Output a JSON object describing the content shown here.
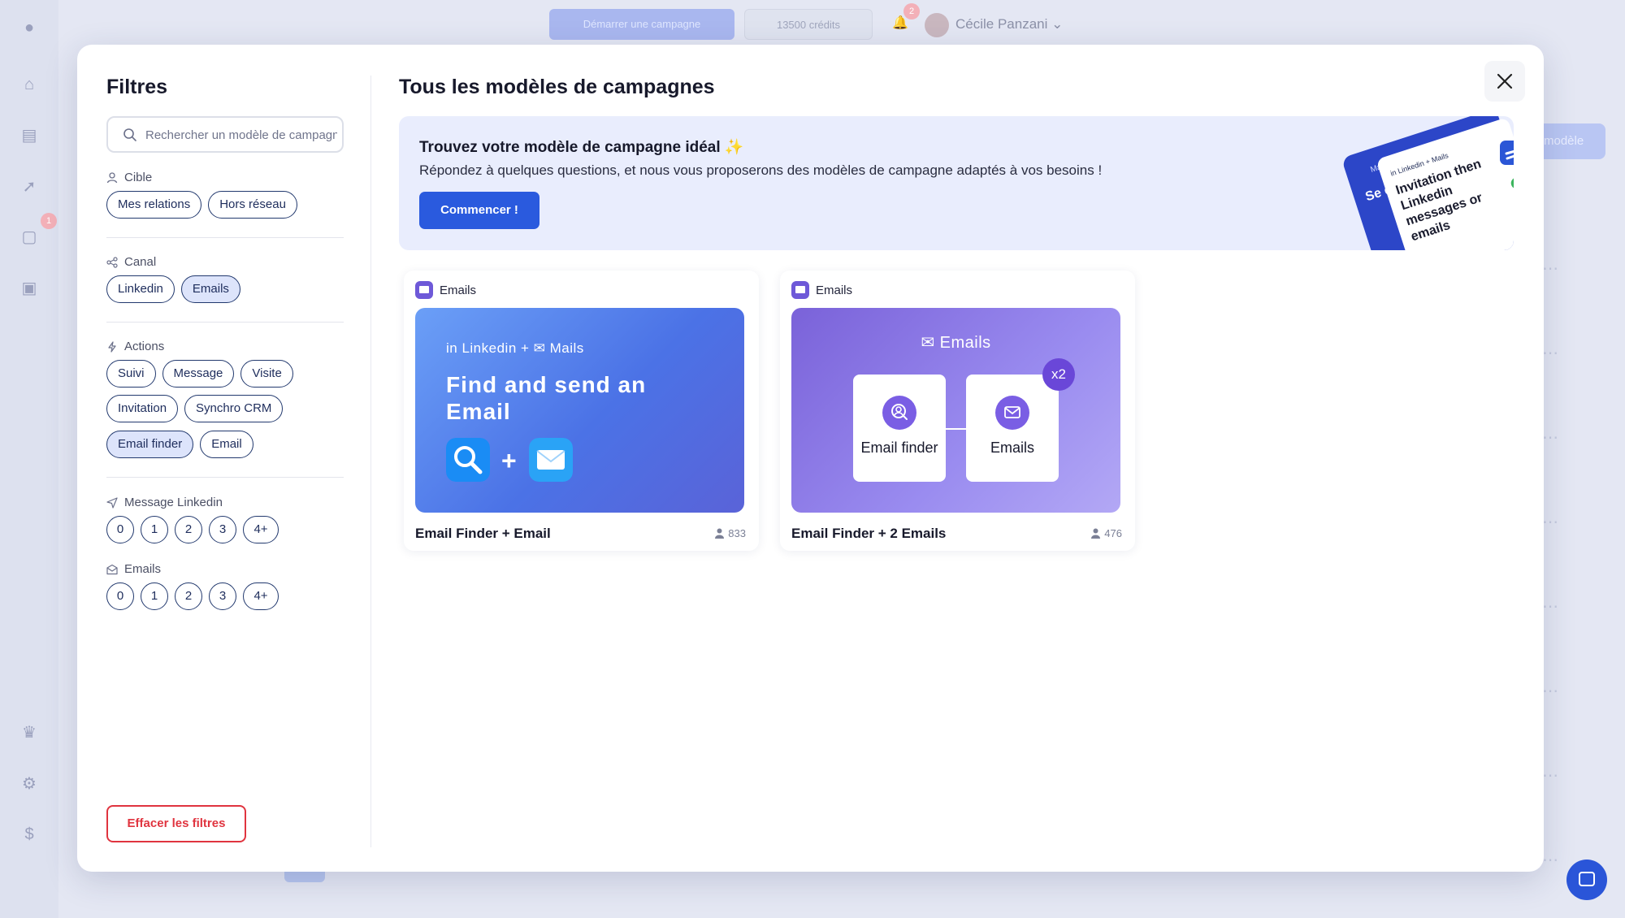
{
  "topbar": {
    "start_campaign": "Démarrer une campagne",
    "credits": "13500 crédits",
    "notifications_count": "2",
    "user_name": "Cécile Panzani"
  },
  "sidebar": {
    "badge_count": "1"
  },
  "background": {
    "right_button_label": "modèle"
  },
  "filters": {
    "title": "Filtres",
    "search_placeholder": "Rechercher un modèle de campagne",
    "target": {
      "label": "Cible",
      "options": [
        "Mes relations",
        "Hors réseau"
      ]
    },
    "channel": {
      "label": "Canal",
      "options": [
        "Linkedin",
        "Emails"
      ],
      "selected": [
        "Emails"
      ]
    },
    "actions": {
      "label": "Actions",
      "options": [
        "Suivi",
        "Message",
        "Visite",
        "Invitation",
        "Synchro CRM",
        "Email finder",
        "Email"
      ],
      "selected": [
        "Email finder"
      ]
    },
    "linkedin_messages": {
      "label": "Message Linkedin",
      "options": [
        "0",
        "1",
        "2",
        "3",
        "4+"
      ]
    },
    "emails": {
      "label": "Emails",
      "options": [
        "0",
        "1",
        "2",
        "3",
        "4+"
      ]
    },
    "clear_button": "Effacer les filtres"
  },
  "main": {
    "title": "Tous les modèles de campagnes",
    "banner": {
      "title": "Trouvez votre modèle de campagne idéal ✨",
      "subtitle": "Répondez à quelques questions, et nous vous proposerons des modèles de campagne adaptés à vos besoins !",
      "button": "Commencer !",
      "illustration": {
        "tag_back": "Mails",
        "tag_front": "in Linkedin + Mails",
        "text_back": "Se en",
        "text_front": "Invitation then Linkedin messages or emails"
      }
    },
    "templates": [
      {
        "channel": "Emails",
        "thumb_channels": "in Linkedin + ✉ Mails",
        "thumb_title": "Find and send an Email",
        "name": "Email Finder + Email",
        "count": "833"
      },
      {
        "channel": "Emails",
        "thumb_header": "Emails",
        "step1": "Email finder",
        "step2": "Emails",
        "multiplier": "x2",
        "name": "Email Finder + 2 Emails",
        "count": "476"
      }
    ]
  },
  "colors": {
    "primary": "#2a5ade",
    "danger": "#e0343f",
    "chip_border": "#22396e",
    "chip_selected_bg": "#dde4fb"
  }
}
